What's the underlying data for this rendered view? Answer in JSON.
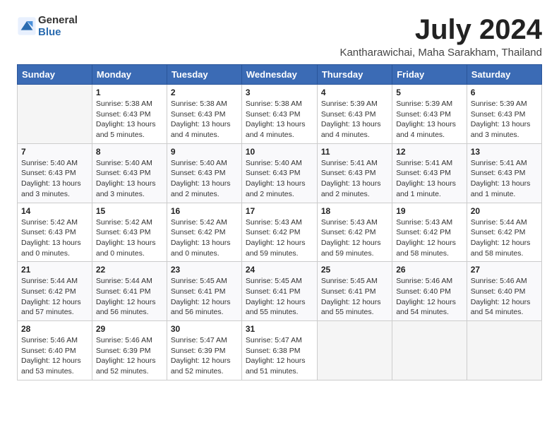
{
  "header": {
    "logo_line1": "General",
    "logo_line2": "Blue",
    "month_year": "July 2024",
    "location": "Kantharawichai, Maha Sarakham, Thailand"
  },
  "days_of_week": [
    "Sunday",
    "Monday",
    "Tuesday",
    "Wednesday",
    "Thursday",
    "Friday",
    "Saturday"
  ],
  "weeks": [
    [
      {
        "day": "",
        "info": ""
      },
      {
        "day": "1",
        "info": "Sunrise: 5:38 AM\nSunset: 6:43 PM\nDaylight: 13 hours\nand 5 minutes."
      },
      {
        "day": "2",
        "info": "Sunrise: 5:38 AM\nSunset: 6:43 PM\nDaylight: 13 hours\nand 4 minutes."
      },
      {
        "day": "3",
        "info": "Sunrise: 5:38 AM\nSunset: 6:43 PM\nDaylight: 13 hours\nand 4 minutes."
      },
      {
        "day": "4",
        "info": "Sunrise: 5:39 AM\nSunset: 6:43 PM\nDaylight: 13 hours\nand 4 minutes."
      },
      {
        "day": "5",
        "info": "Sunrise: 5:39 AM\nSunset: 6:43 PM\nDaylight: 13 hours\nand 4 minutes."
      },
      {
        "day": "6",
        "info": "Sunrise: 5:39 AM\nSunset: 6:43 PM\nDaylight: 13 hours\nand 3 minutes."
      }
    ],
    [
      {
        "day": "7",
        "info": "Sunrise: 5:40 AM\nSunset: 6:43 PM\nDaylight: 13 hours\nand 3 minutes."
      },
      {
        "day": "8",
        "info": "Sunrise: 5:40 AM\nSunset: 6:43 PM\nDaylight: 13 hours\nand 3 minutes."
      },
      {
        "day": "9",
        "info": "Sunrise: 5:40 AM\nSunset: 6:43 PM\nDaylight: 13 hours\nand 2 minutes."
      },
      {
        "day": "10",
        "info": "Sunrise: 5:40 AM\nSunset: 6:43 PM\nDaylight: 13 hours\nand 2 minutes."
      },
      {
        "day": "11",
        "info": "Sunrise: 5:41 AM\nSunset: 6:43 PM\nDaylight: 13 hours\nand 2 minutes."
      },
      {
        "day": "12",
        "info": "Sunrise: 5:41 AM\nSunset: 6:43 PM\nDaylight: 13 hours\nand 1 minute."
      },
      {
        "day": "13",
        "info": "Sunrise: 5:41 AM\nSunset: 6:43 PM\nDaylight: 13 hours\nand 1 minute."
      }
    ],
    [
      {
        "day": "14",
        "info": "Sunrise: 5:42 AM\nSunset: 6:43 PM\nDaylight: 13 hours\nand 0 minutes."
      },
      {
        "day": "15",
        "info": "Sunrise: 5:42 AM\nSunset: 6:43 PM\nDaylight: 13 hours\nand 0 minutes."
      },
      {
        "day": "16",
        "info": "Sunrise: 5:42 AM\nSunset: 6:42 PM\nDaylight: 13 hours\nand 0 minutes."
      },
      {
        "day": "17",
        "info": "Sunrise: 5:43 AM\nSunset: 6:42 PM\nDaylight: 12 hours\nand 59 minutes."
      },
      {
        "day": "18",
        "info": "Sunrise: 5:43 AM\nSunset: 6:42 PM\nDaylight: 12 hours\nand 59 minutes."
      },
      {
        "day": "19",
        "info": "Sunrise: 5:43 AM\nSunset: 6:42 PM\nDaylight: 12 hours\nand 58 minutes."
      },
      {
        "day": "20",
        "info": "Sunrise: 5:44 AM\nSunset: 6:42 PM\nDaylight: 12 hours\nand 58 minutes."
      }
    ],
    [
      {
        "day": "21",
        "info": "Sunrise: 5:44 AM\nSunset: 6:42 PM\nDaylight: 12 hours\nand 57 minutes."
      },
      {
        "day": "22",
        "info": "Sunrise: 5:44 AM\nSunset: 6:41 PM\nDaylight: 12 hours\nand 56 minutes."
      },
      {
        "day": "23",
        "info": "Sunrise: 5:45 AM\nSunset: 6:41 PM\nDaylight: 12 hours\nand 56 minutes."
      },
      {
        "day": "24",
        "info": "Sunrise: 5:45 AM\nSunset: 6:41 PM\nDaylight: 12 hours\nand 55 minutes."
      },
      {
        "day": "25",
        "info": "Sunrise: 5:45 AM\nSunset: 6:41 PM\nDaylight: 12 hours\nand 55 minutes."
      },
      {
        "day": "26",
        "info": "Sunrise: 5:46 AM\nSunset: 6:40 PM\nDaylight: 12 hours\nand 54 minutes."
      },
      {
        "day": "27",
        "info": "Sunrise: 5:46 AM\nSunset: 6:40 PM\nDaylight: 12 hours\nand 54 minutes."
      }
    ],
    [
      {
        "day": "28",
        "info": "Sunrise: 5:46 AM\nSunset: 6:40 PM\nDaylight: 12 hours\nand 53 minutes."
      },
      {
        "day": "29",
        "info": "Sunrise: 5:46 AM\nSunset: 6:39 PM\nDaylight: 12 hours\nand 52 minutes."
      },
      {
        "day": "30",
        "info": "Sunrise: 5:47 AM\nSunset: 6:39 PM\nDaylight: 12 hours\nand 52 minutes."
      },
      {
        "day": "31",
        "info": "Sunrise: 5:47 AM\nSunset: 6:38 PM\nDaylight: 12 hours\nand 51 minutes."
      },
      {
        "day": "",
        "info": ""
      },
      {
        "day": "",
        "info": ""
      },
      {
        "day": "",
        "info": ""
      }
    ]
  ]
}
